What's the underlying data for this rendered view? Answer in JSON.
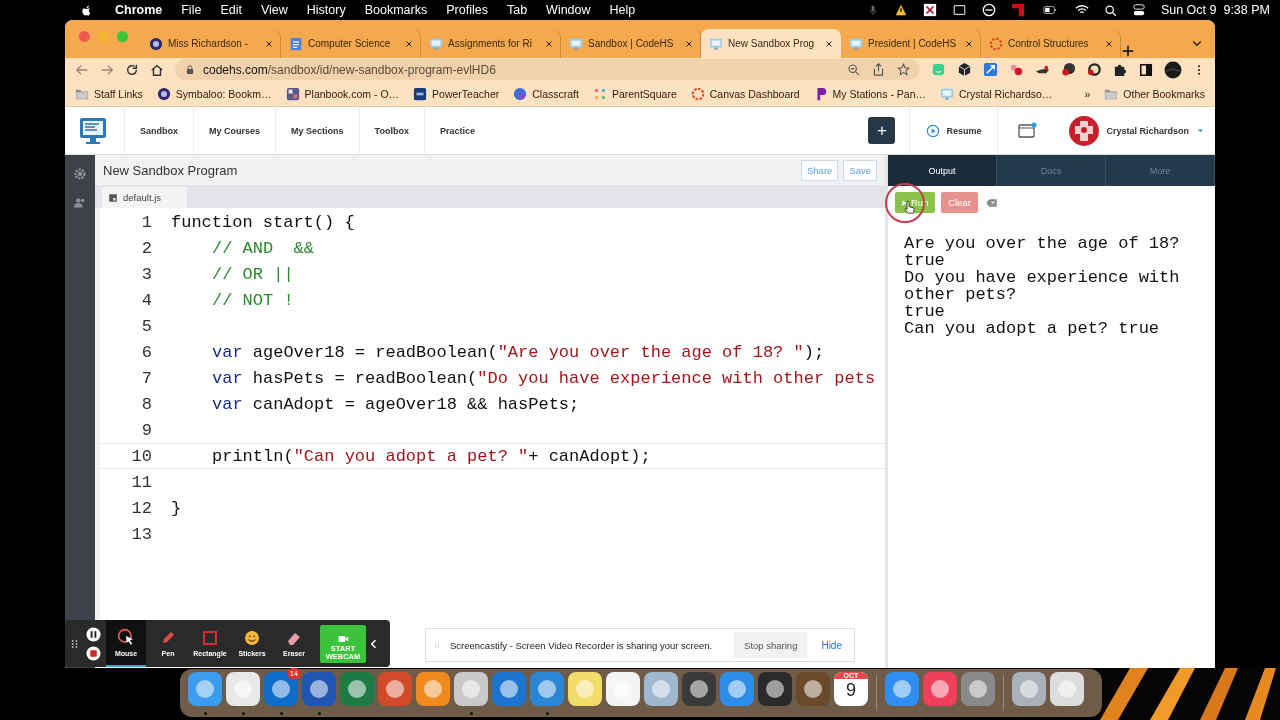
{
  "menu_bar": {
    "items": [
      {
        "label": "Chrome",
        "bold": true
      },
      {
        "label": "File",
        "bold": false
      },
      {
        "label": "Edit",
        "bold": false
      },
      {
        "label": "View",
        "bold": false
      },
      {
        "label": "History",
        "bold": false
      },
      {
        "label": "Bookmarks",
        "bold": false
      },
      {
        "label": "Profiles",
        "bold": false
      },
      {
        "label": "Tab",
        "bold": false
      },
      {
        "label": "Window",
        "bold": false
      },
      {
        "label": "Help",
        "bold": false
      }
    ],
    "clock": "Sun Oct 9  9:38 PM"
  },
  "browser": {
    "tabs": [
      {
        "title": "Miss Richardson -",
        "kind": "circle",
        "selected": false
      },
      {
        "title": "Computer Science",
        "kind": "doc",
        "selected": false
      },
      {
        "title": "Assignments for Ri",
        "kind": "monitor",
        "selected": false
      },
      {
        "title": "Sandbox | CodeHS",
        "kind": "monitor",
        "selected": false
      },
      {
        "title": "New Sandbox Prog",
        "kind": "monitor",
        "selected": true
      },
      {
        "title": "President | CodeHS",
        "kind": "monitor",
        "selected": false
      },
      {
        "title": "Control Structures",
        "kind": "ring",
        "selected": false
      }
    ],
    "url": {
      "host": "codehs.com",
      "path": "/sandbox/id/new-sandbox-program-evlHD6"
    },
    "bookmarks": [
      {
        "label": "Staff Links",
        "kind": "folder"
      },
      {
        "label": "Symbaloo: Bookm…",
        "kind": "circle"
      },
      {
        "label": "Planbook.com - O…",
        "kind": "grid"
      },
      {
        "label": "PowerTeacher",
        "kind": "square"
      },
      {
        "label": "Classcraft",
        "kind": "globe"
      },
      {
        "label": "ParentSquare",
        "kind": "dots"
      },
      {
        "label": "Canvas Dashboard",
        "kind": "ring"
      },
      {
        "label": "My Stations - Pan…",
        "kind": "flag"
      },
      {
        "label": "Crystal Richardso…",
        "kind": "monitor"
      }
    ],
    "overflow": "»",
    "other_bookmarks": "Other Bookmarks"
  },
  "site_header": {
    "nav": [
      "Sandbox",
      "My Courses",
      "My Sections",
      "Toolbox",
      "Practice"
    ],
    "add": "+",
    "resume": "Resume",
    "user": "Crystal Richardson"
  },
  "editor": {
    "title": "New Sandbox Program",
    "buttons": [
      "Share",
      "Save"
    ],
    "file": "default.js",
    "lines": [
      {
        "number": "1",
        "indented": false,
        "active": false,
        "tokens": [
          {
            "kind": "plain",
            "text": "function start() {"
          }
        ]
      },
      {
        "number": "2",
        "indented": true,
        "active": false,
        "tokens": [
          {
            "kind": "comment",
            "text": "// AND  &&"
          }
        ]
      },
      {
        "number": "3",
        "indented": true,
        "active": false,
        "tokens": [
          {
            "kind": "comment",
            "text": "// OR ||"
          }
        ]
      },
      {
        "number": "4",
        "indented": true,
        "active": false,
        "tokens": [
          {
            "kind": "comment",
            "text": "// NOT !"
          }
        ]
      },
      {
        "number": "5",
        "active": false
      },
      {
        "number": "6",
        "indented": true,
        "active": false,
        "tokens": [
          {
            "kind": "keyword",
            "text": "var"
          },
          {
            "kind": "plain",
            "text": " ageOver18 = readBoolean("
          },
          {
            "kind": "string",
            "text": "\"Are you over the age of 18? \""
          },
          {
            "kind": "plain",
            "text": ");"
          }
        ]
      },
      {
        "number": "7",
        "indented": true,
        "active": false,
        "tokens": [
          {
            "kind": "keyword",
            "text": "var"
          },
          {
            "kind": "plain",
            "text": " hasPets = readBoolean("
          },
          {
            "kind": "string",
            "text": "\"Do you have experience with other pets"
          }
        ]
      },
      {
        "number": "8",
        "indented": true,
        "active": false,
        "tokens": [
          {
            "kind": "keyword",
            "text": "var"
          },
          {
            "kind": "plain",
            "text": " canAdopt = ageOver18 && hasPets;"
          }
        ]
      },
      {
        "number": "9",
        "active": false
      },
      {
        "number": "10",
        "indented": true,
        "active": true,
        "tokens": [
          {
            "kind": "plain",
            "text": "println("
          },
          {
            "kind": "string",
            "text": "\"Can you adopt a pet? \""
          },
          {
            "kind": "plain",
            "text": "+ canAdopt);"
          }
        ]
      },
      {
        "number": "11",
        "active": false
      },
      {
        "number": "12",
        "indented": false,
        "active": false,
        "tokens": [
          {
            "kind": "plain",
            "text": "}"
          }
        ]
      },
      {
        "number": "13",
        "active": false
      }
    ]
  },
  "output_panel": {
    "tabs": [
      {
        "label": "Output",
        "selected": true
      },
      {
        "label": "Docs",
        "selected": false
      },
      {
        "label": "More",
        "selected": false
      }
    ],
    "run": "Run",
    "clear": "Clear",
    "output": [
      "Are you over the age of 18?",
      "true",
      "Do you have experience with other pets?",
      "true",
      "Can you adopt a pet? true"
    ]
  },
  "recorder_toolbar": {
    "tools": [
      {
        "label": "Mouse",
        "kind": "mouse",
        "selected": true
      },
      {
        "label": "Pen",
        "kind": "pen",
        "selected": false
      },
      {
        "label": "Rectangle",
        "kind": "rectangle",
        "selected": false
      },
      {
        "label": "Stickers",
        "kind": "sticker",
        "selected": false
      },
      {
        "label": "Eraser",
        "kind": "eraser",
        "selected": false
      }
    ],
    "webcam": "START WEBCAM"
  },
  "share_notice": {
    "message": "Screencastify - Screen Video Recorder is sharing your screen.",
    "stop": "Stop sharing",
    "hide": "Hide"
  },
  "dock": [
    {
      "kind": "app",
      "color": "#3b9cf0",
      "running": true
    },
    {
      "kind": "app",
      "color": "#e8e8e8",
      "running": true
    },
    {
      "kind": "app",
      "color": "#0f6cc9",
      "running": true,
      "badge": "14"
    },
    {
      "kind": "app",
      "color": "#2057b5",
      "running": true
    },
    {
      "kind": "app",
      "color": "#1e7b46",
      "running": false
    },
    {
      "kind": "app",
      "color": "#d04a2a",
      "running": false
    },
    {
      "kind": "app",
      "color": "#f08a1e",
      "running": false
    },
    {
      "kind": "app",
      "color": "#c9c9c9",
      "running": true
    },
    {
      "kind": "app",
      "color": "#1d74d0",
      "running": false
    },
    {
      "kind": "app",
      "color": "#2c86d6",
      "running": true
    },
    {
      "kind": "app",
      "color": "#f3dd6a",
      "running": false
    },
    {
      "kind": "app",
      "color": "#f4f4f4",
      "running": false
    },
    {
      "kind": "app",
      "color": "#9fb7cf",
      "running": false
    },
    {
      "kind": "app",
      "color": "#3a3a3a",
      "running": false
    },
    {
      "kind": "app",
      "color": "#2d8ee9",
      "running": false
    },
    {
      "kind": "app",
      "color": "#2a2a2a",
      "running": false
    },
    {
      "kind": "app",
      "color": "#6b4a2b",
      "running": false
    },
    {
      "kind": "calendar",
      "month": "OCT",
      "day": "9",
      "running": false
    },
    {
      "kind": "separator"
    },
    {
      "kind": "app",
      "color": "#2f8ff0",
      "running": false
    },
    {
      "kind": "app",
      "color": "#ef3f5a",
      "running": false
    },
    {
      "kind": "app",
      "color": "#8a8a8a",
      "running": false
    },
    {
      "kind": "separator"
    },
    {
      "kind": "app",
      "color": "#a9b2bb",
      "running": false
    },
    {
      "kind": "app",
      "color": "#dcdcdc",
      "running": false
    }
  ]
}
